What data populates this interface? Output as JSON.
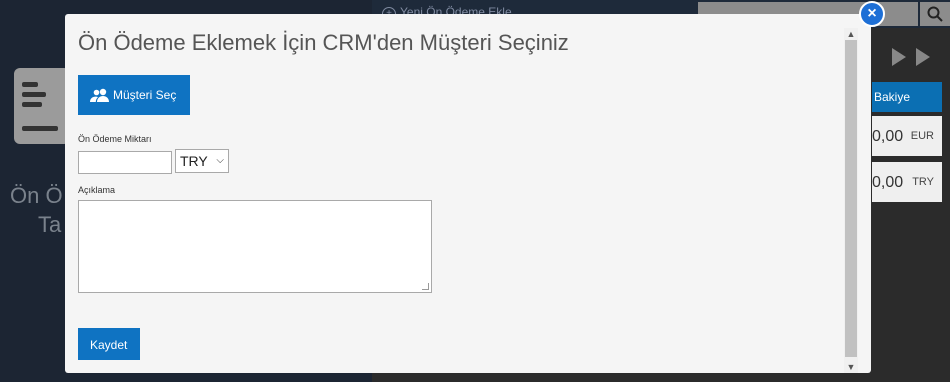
{
  "background": {
    "new_prepayment_link": "Yeni Ön Ödeme Ekle",
    "title_line1": "Ön Ö",
    "title_line2": "Ta",
    "balance_header": "Bakiye",
    "rows": [
      {
        "amount": "0,00",
        "currency": "EUR"
      },
      {
        "amount": "0,00",
        "currency": "TRY"
      }
    ]
  },
  "modal": {
    "title": "Ön Ödeme Eklemek İçin CRM'den Müşteri Seçiniz",
    "select_customer_label": "Müşteri Seç",
    "amount_label": "Ön Ödeme Miktarı",
    "amount_value": "",
    "currency_selected": "TRY",
    "description_label": "Açıklama",
    "description_value": "",
    "save_label": "Kaydet",
    "close_label": "×"
  },
  "colors": {
    "primary": "#0f73c2",
    "close": "#1d6fd6"
  }
}
